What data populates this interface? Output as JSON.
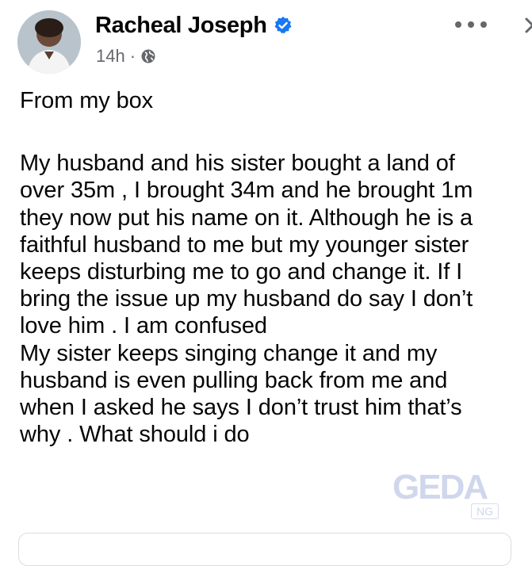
{
  "post": {
    "author": "Racheal Joseph",
    "timestamp": "14h",
    "separator": "·",
    "audience_icon": "globe-icon",
    "verified_icon": "verified-badge-icon",
    "lines": [
      "From my box",
      "My husband and his sister bought a land of",
      "over 35m , I brought 34m and he brought 1m",
      "they now put his name on it. Although he is a",
      "faithful husband to me but my younger sister",
      "keeps disturbing me to go and change it. If I",
      "bring the issue up my husband do say I don’t",
      "love him . I am confused",
      "My sister keeps singing change it and my",
      "husband is even pulling back from me and",
      "when I asked he says I don’t trust him that’s",
      "why . What should i do"
    ]
  },
  "actions": {
    "more_icon": "more-icon",
    "close_icon": "close-icon"
  },
  "watermark": {
    "text": "GEDA",
    "sub": "NG"
  },
  "colors": {
    "verified_blue": "#1877f2",
    "meta_gray": "#65676b",
    "text": "#050505"
  }
}
